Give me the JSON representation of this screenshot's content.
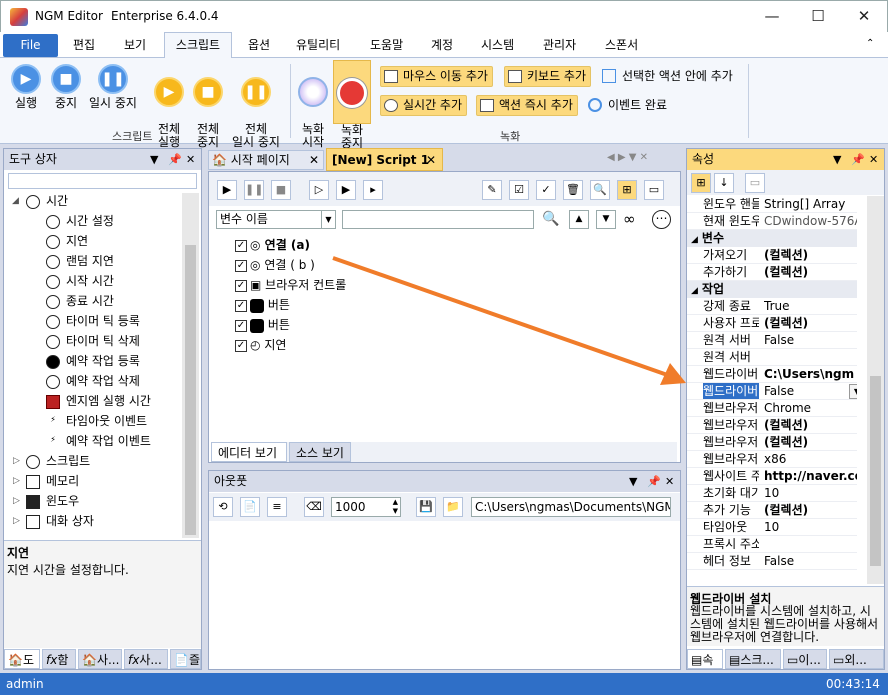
{
  "window": {
    "app": "NGM Editor",
    "edition": "Enterprise 6.4.0.4"
  },
  "menu": [
    "File",
    "편집",
    "보기",
    "스크립트",
    "옵션",
    "유틸리티",
    "도움말",
    "계정",
    "시스템",
    "관리자",
    "스폰서"
  ],
  "ribbon": {
    "run": "실행",
    "stop": "중지",
    "pause": "일시 중지",
    "all_run": "전체\n실행",
    "all_stop": "전체\n중지",
    "all_pause": "전체\n일시 중지",
    "rec_start": "녹화\n시작",
    "rec_stop": "녹화\n중지",
    "mouse_move": "마우스 이동 추가",
    "keyboard_add": "키보드 추가",
    "inside_action": "선택한 액션 안에 추가",
    "realtime_add": "실시간 추가",
    "action_now": "액션 즉시 추가",
    "event_done": "이벤트 완료",
    "group_script": "스크립트",
    "group_record": "녹화"
  },
  "toolbox": {
    "title": "도구 상자",
    "items": [
      "시간",
      "시간 설정",
      "지연",
      "랜덤 지연",
      "시작 시간",
      "종료 시간",
      "타이머 틱 등록",
      "타이머 틱 삭제",
      "예약 작업 등록",
      "예약 작업 삭제",
      "엔지엠 실행 시간",
      "타임아웃 이벤트",
      "예약 작업 이벤트"
    ],
    "groups": [
      "스크립트",
      "메모리",
      "윈도우",
      "대화 상자"
    ],
    "desc_title": "지연",
    "desc_text": "지연 시간을 설정합니다.",
    "bottom_tabs": [
      "도",
      "함",
      "사...",
      "사...",
      "즐"
    ]
  },
  "doc_tabs": {
    "start": "시작 페이지",
    "script": "[New] Script 1"
  },
  "editor": {
    "var_select": "변수 이름",
    "commands": [
      "연결 (a)",
      "연결 ( b )",
      "브라우저 컨트롤",
      "버튼",
      "버튼",
      "지연"
    ],
    "bottom_tabs": [
      "에디터 보기",
      "소스 보기"
    ]
  },
  "output": {
    "title": "아웃풋",
    "count": "1000",
    "path": "C:\\Users\\ngmas\\Documents\\NGM6\\"
  },
  "props": {
    "title": "속성",
    "rows": [
      {
        "n": "윈도우 핸들",
        "v": "String[] Array"
      },
      {
        "n": "현재 윈도우",
        "v": "CDwindow-576AS"
      },
      {
        "cat": "변수"
      },
      {
        "n": "가져오기",
        "v": "(컬렉션)"
      },
      {
        "n": "추가하기",
        "v": "(컬렉션)"
      },
      {
        "cat": "작업"
      },
      {
        "n": "강제 종료",
        "v": "True"
      },
      {
        "n": "사용자 프로",
        "v": "(컬렉션)"
      },
      {
        "n": "원격 서버",
        "v": "False"
      },
      {
        "n": "원격 서버",
        "v": ""
      },
      {
        "n": "웹드라이버",
        "v": "C:\\Users\\ngm"
      },
      {
        "n": "웹드라이버",
        "v": "False",
        "sel": true
      },
      {
        "n": "웹브라우저",
        "v": "Chrome"
      },
      {
        "n": "웹브라우저",
        "v": "(컬렉션)"
      },
      {
        "n": "웹브라우저",
        "v": "(컬렉션)"
      },
      {
        "n": "웹브라우저",
        "v": "x86"
      },
      {
        "n": "웹사이트 주",
        "v": "http://naver.co"
      },
      {
        "n": "초기화 대기",
        "v": "10"
      },
      {
        "n": "추가 기능",
        "v": "(컬렉션)"
      },
      {
        "n": "타임아웃",
        "v": "10"
      },
      {
        "n": "프록시 주소",
        "v": ""
      },
      {
        "n": "헤더 정보",
        "v": "False"
      }
    ],
    "desc_title": "웹드라이버 설치",
    "desc_text": "웹드라이버를 시스템에 설치하고, 시스템에 설치된 웹드라이버를 사용해서 웹브라우저에 연결합니다.",
    "bottom_tabs": [
      "속",
      "스크...",
      "이...",
      "외..."
    ]
  },
  "status": {
    "user": "admin",
    "time": "00:43:14"
  },
  "colors": {
    "accent": "#2f6fc7",
    "highlight": "#fcd97d",
    "arrow": "#f07c2a"
  }
}
